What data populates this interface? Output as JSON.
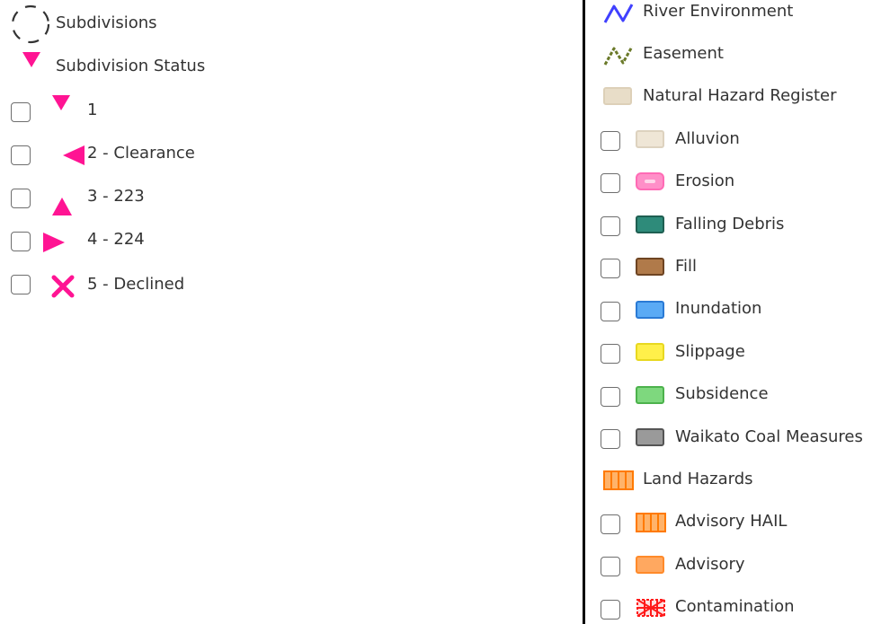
{
  "left_panel": {
    "subdivisions": {
      "label": "Subdivisions",
      "icon": "dashed-circle-icon"
    },
    "status": {
      "label": "Subdivision Status",
      "icon": "triangle-down-icon",
      "color": "#ff1493"
    },
    "items": [
      {
        "label": "1",
        "icon": "triangle-down-icon"
      },
      {
        "label": "2 - Clearance",
        "icon": "triangle-left-icon"
      },
      {
        "label": "3 - 223",
        "icon": "triangle-up-icon"
      },
      {
        "label": "4 - 224",
        "icon": "triangle-right-icon"
      },
      {
        "label": "5 - Declined",
        "icon": "x-mark-icon"
      }
    ]
  },
  "right_panel": {
    "river": {
      "label": "River Environment",
      "icon": "zigzag-line-icon",
      "color": "#4040ff"
    },
    "easement": {
      "label": "Easement",
      "icon": "zigzag-line-icon",
      "color": "#6b7a2a"
    },
    "nhr": {
      "label": "Natural Hazard Register",
      "color": "#e8ddc8"
    },
    "hazards": [
      {
        "label": "Alluvion",
        "fill": "#efe6d6",
        "stroke": "#ddd2bf"
      },
      {
        "label": "Erosion",
        "fill": "#ff8fc8",
        "stroke": "#ff6bb5"
      },
      {
        "label": "Falling Debris",
        "fill": "#2e8b7a",
        "stroke": "#1f5f52"
      },
      {
        "label": "Fill",
        "fill": "#b07a4a",
        "stroke": "#6e4422"
      },
      {
        "label": "Inundation",
        "fill": "#5aaaf5",
        "stroke": "#2a7ad5"
      },
      {
        "label": "Slippage",
        "fill": "#fff04a",
        "stroke": "#e8d820"
      },
      {
        "label": "Subsidence",
        "fill": "#7ed87e",
        "stroke": "#4cb24c"
      },
      {
        "label": "Waikato Coal Measures",
        "fill": "#9a9a9a",
        "stroke": "#555555"
      }
    ],
    "land_hazards": {
      "label": "Land Hazards",
      "color": "#ff8c1a"
    },
    "land_items": [
      {
        "label": "Advisory HAIL",
        "fill": "#ffb36a",
        "stroke": "#ff7a00"
      },
      {
        "label": "Advisory",
        "fill": "#ffa860",
        "stroke": "#ff8a2a"
      },
      {
        "label": "Contamination",
        "fill": "#ff2020",
        "stroke": "#e00000"
      }
    ]
  }
}
